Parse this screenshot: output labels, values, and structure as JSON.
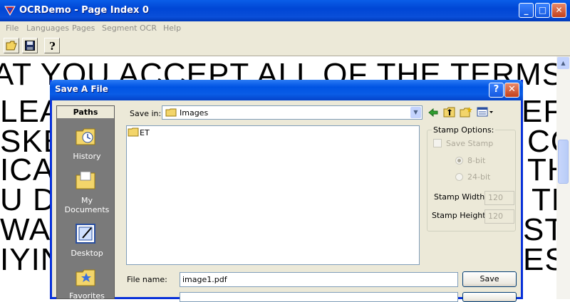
{
  "window": {
    "title": "OCRDemo - Page Index 0"
  },
  "menubar": {
    "items": [
      "File",
      "Languages",
      "Pages",
      "Segment",
      "OCR",
      "Help"
    ]
  },
  "document": {
    "lines": [
      "AT YOU ACCEPT ALL OF THE TERMS CONTA",
      "LEAS",
      "SKE",
      "ICA",
      "U DO",
      "WAR",
      "IYIN"
    ],
    "right_fragments": [
      "EFC",
      "CC",
      "TH",
      "TE",
      "ST",
      "ES"
    ]
  },
  "dialog": {
    "title": "Save A File",
    "paths_header": "Paths",
    "places": [
      "History",
      "My Documents",
      "Desktop",
      "Favorites"
    ],
    "save_in_label": "Save in:",
    "save_in_value": "Images",
    "files": [
      "ET"
    ],
    "file_name_label": "File name:",
    "file_name_value": "image1.pdf",
    "save_button": "Save",
    "stamp": {
      "legend": "Stamp Options:",
      "save_stamp": "Save Stamp",
      "bit8": "8-bit",
      "bit24": "24-bit",
      "width_label": "Stamp Width:",
      "width_value": "120",
      "height_label": "Stamp Height:",
      "height_value": "120"
    }
  }
}
